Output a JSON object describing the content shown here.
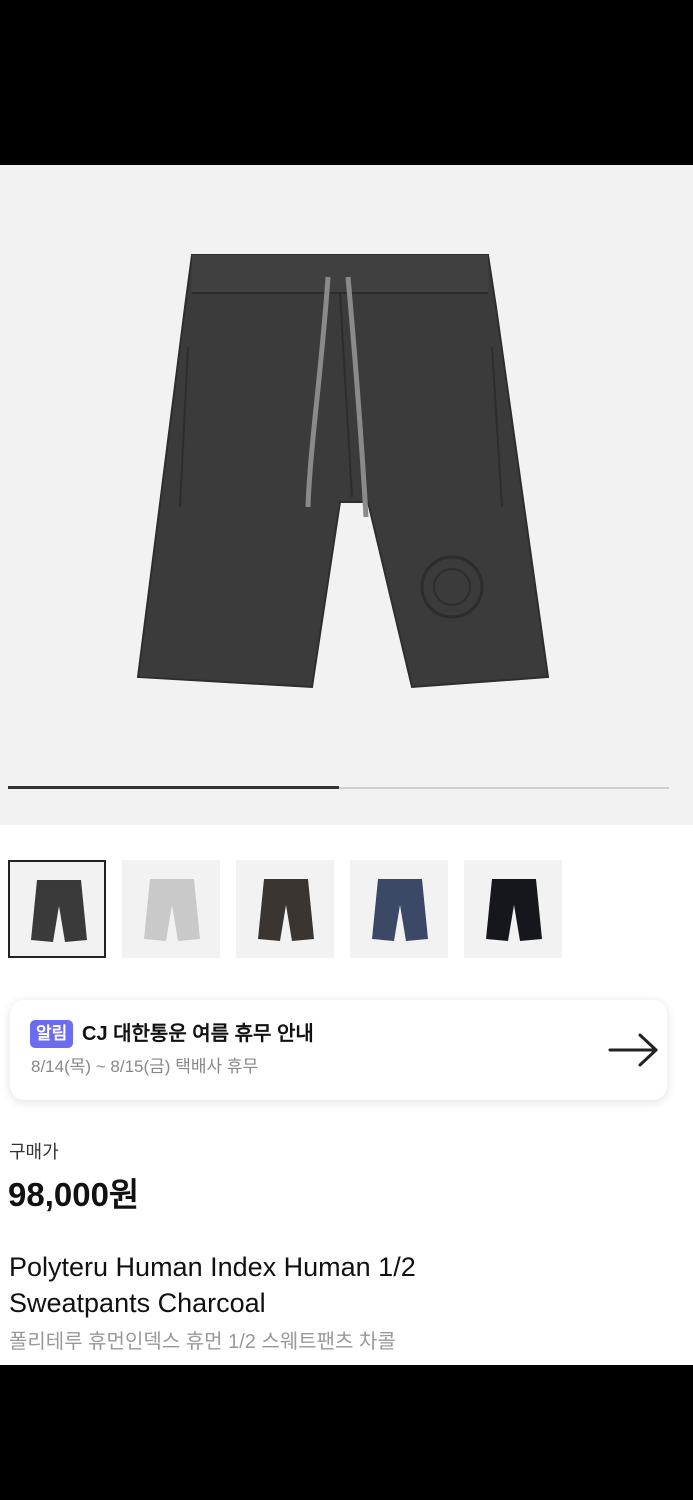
{
  "gallery": {
    "progress_fraction": 0.5,
    "thumbnails": [
      {
        "color": "charcoal",
        "fill": "#3a3a3a",
        "selected": true
      },
      {
        "color": "grey",
        "fill": "#c9c9c9",
        "selected": false
      },
      {
        "color": "brown",
        "fill": "#3b3532",
        "selected": false
      },
      {
        "color": "navy",
        "fill": "#3b4966",
        "selected": false
      },
      {
        "color": "black",
        "fill": "#15171c",
        "selected": false
      }
    ]
  },
  "notice": {
    "badge": "알림",
    "title": "CJ 대한통운 여름 휴무 안내",
    "subtitle": "8/14(목) ~ 8/15(금) 택배사 휴무",
    "arrow_icon": "arrow-right-icon"
  },
  "price": {
    "label": "구매가",
    "value": "98,000원"
  },
  "product": {
    "name_en": "Polyteru Human Index Human 1/2 Sweatpants Charcoal",
    "name_ko": "폴리테루 휴먼인덱스 휴먼 1/2 스웨트팬츠 차콜"
  },
  "colors": {
    "badge": "#6b6cf0",
    "main_product": "#3b3b3b"
  }
}
